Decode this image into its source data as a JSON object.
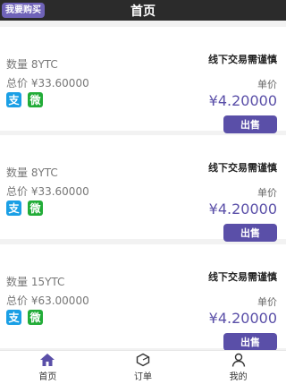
{
  "header": {
    "title": "首页",
    "buy_button": "我要购买"
  },
  "listings": [
    {
      "quantity": "数量 8YTC",
      "total": "总价 ¥33.60000",
      "notice": "线下交易需谨慎",
      "unit_price_label": "单价",
      "unit_price": "¥4.20000",
      "sell_button": "出售"
    },
    {
      "quantity": "数量 8YTC",
      "total": "总价 ¥33.60000",
      "notice": "线下交易需谨慎",
      "unit_price_label": "单价",
      "unit_price": "¥4.20000",
      "sell_button": "出售"
    },
    {
      "quantity": "数量 15YTC",
      "total": "总价 ¥63.00000",
      "notice": "线下交易需谨慎",
      "unit_price_label": "单价",
      "unit_price": "¥4.20000",
      "sell_button": "出售"
    }
  ],
  "payment_icons": {
    "alipay": "支",
    "wechat": "微"
  },
  "tabbar": [
    {
      "label": "首页",
      "icon": "home-icon",
      "active": true
    },
    {
      "label": "订单",
      "icon": "order-icon",
      "active": false
    },
    {
      "label": "我的",
      "icon": "profile-icon",
      "active": false
    }
  ],
  "colors": {
    "accent": "#5a4fa8",
    "header_bg": "#2b2b2b",
    "alipay": "#1a9fe5",
    "wechat": "#22ac38"
  }
}
